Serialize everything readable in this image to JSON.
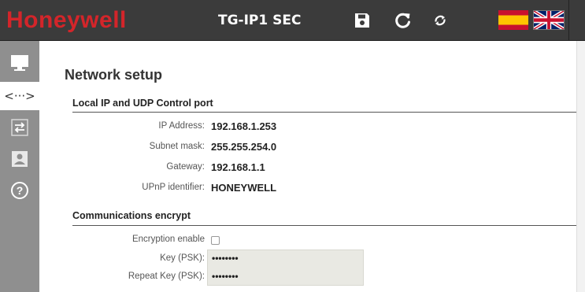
{
  "header": {
    "brand": "Honeywell",
    "device_title": "TG-IP1 SEC",
    "icons": [
      "save-icon",
      "reload-icon",
      "sync-icon"
    ],
    "languages": [
      "spanish-flag",
      "uk-flag"
    ],
    "colors": {
      "bar": "#3b3b3b",
      "brand": "#d3252a"
    }
  },
  "sidebar": {
    "items": [
      {
        "icon": "monitor-icon",
        "active": false
      },
      {
        "icon": "network-icon",
        "label": "<···>",
        "active": true
      },
      {
        "icon": "transfer-icon",
        "active": false
      },
      {
        "icon": "user-icon",
        "active": false
      },
      {
        "icon": "help-icon",
        "label": "?",
        "active": false
      }
    ]
  },
  "main": {
    "title": "Network setup",
    "section_local": "Local IP and UDP Control port",
    "fields": [
      {
        "label": "IP Address:",
        "value": "192.168.1.253"
      },
      {
        "label": "Subnet mask:",
        "value": "255.255.254.0"
      },
      {
        "label": "Gateway:",
        "value": "192.168.1.1"
      },
      {
        "label": "UPnP identifier:",
        "value": "HONEYWELL"
      }
    ],
    "section_enc": "Communications encrypt",
    "encryption": {
      "enable_label": "Encryption enable",
      "enabled": false,
      "key_label": "Key (PSK):",
      "key_value": "••••••••",
      "repeat_label": "Repeat Key (PSK):",
      "repeat_value": "••••••••"
    }
  }
}
